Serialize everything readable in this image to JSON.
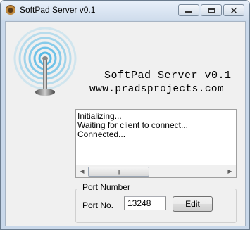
{
  "window": {
    "title": "SoftPad Server v0.1",
    "icon": "app-icon",
    "controls": {
      "minimize": "minimize-icon",
      "maximize": "maximize-icon",
      "close": "close-icon"
    }
  },
  "header": {
    "logo_icon": "wireless-antenna-icon",
    "app_name": "SoftPad Server v0.1",
    "url": "www.pradsprojects.com"
  },
  "log": {
    "lines": [
      "Initializing...",
      "Waiting for client to connect...",
      "Connected..."
    ]
  },
  "port_group": {
    "title": "Port Number",
    "label": "Port No.",
    "value": "13248",
    "edit_label": "Edit"
  },
  "colors": {
    "title_bar": "#cfdcec",
    "client_bg": "#f0f0f0",
    "antenna_waves": "#4fb7e6"
  }
}
